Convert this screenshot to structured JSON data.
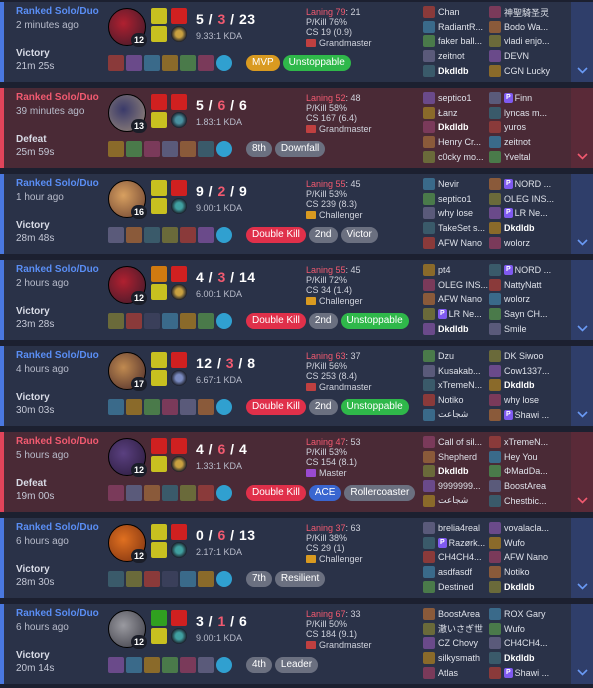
{
  "colors": {
    "win": "#4a78e0",
    "loss": "#e0445a",
    "accent_gold": "#d99a20"
  },
  "matches": [
    {
      "mode": "Ranked Solo/Duo",
      "ago": "2 minutes ago",
      "result": "Victory",
      "duration": "21m 25s",
      "outcome": "win",
      "level": "12",
      "k": "5",
      "d": "3",
      "a": "23",
      "kda": "9.33:1 KDA",
      "laning": "Laning 79",
      "laning_score": ": 21",
      "pkill": "P/Kill 76%",
      "cs": "CS 19 (0.9)",
      "rank": "Grandmaster",
      "tags": [
        {
          "label": "MVP",
          "color": "gold"
        },
        {
          "label": "Unstoppable",
          "color": "green"
        }
      ],
      "team1": [
        {
          "name": "Chan"
        },
        {
          "name": "RadiantR..."
        },
        {
          "name": "faker ball..."
        },
        {
          "name": "zeitnot"
        },
        {
          "name": "Dkdldb",
          "me": true
        }
      ],
      "team2": [
        {
          "name": "神聖騎圣灵"
        },
        {
          "name": "Bodo Wa..."
        },
        {
          "name": "vladi enjo..."
        },
        {
          "name": "DEVN"
        },
        {
          "name": "CGN Lucky"
        }
      ]
    },
    {
      "mode": "Ranked Solo/Duo",
      "ago": "39 minutes ago",
      "result": "Defeat",
      "duration": "25m 59s",
      "outcome": "loss",
      "level": "13",
      "k": "5",
      "d": "6",
      "a": "6",
      "kda": "1.83:1 KDA",
      "laning": "Laning 52",
      "laning_score": ": 48",
      "pkill": "P/Kill 58%",
      "cs": "CS 167 (6.4)",
      "rank": "Grandmaster",
      "tags": [
        {
          "label": "8th",
          "color": "gray"
        },
        {
          "label": "Downfall",
          "color": "gray"
        }
      ],
      "team1": [
        {
          "name": "septico1"
        },
        {
          "name": "Łanz"
        },
        {
          "name": "Dkdldb",
          "me": true
        },
        {
          "name": "Henry Cr..."
        },
        {
          "name": "c0cky mo..."
        }
      ],
      "team2": [
        {
          "name": "Finn",
          "badge": "P"
        },
        {
          "name": "lyncas m..."
        },
        {
          "name": "yuros"
        },
        {
          "name": "zeitnot"
        },
        {
          "name": "Yveltal"
        }
      ]
    },
    {
      "mode": "Ranked Solo/Duo",
      "ago": "1 hour ago",
      "result": "Victory",
      "duration": "28m 48s",
      "outcome": "win",
      "level": "16",
      "k": "9",
      "d": "2",
      "a": "9",
      "kda": "9.00:1 KDA",
      "laning": "Laning 55",
      "laning_score": ": 45",
      "pkill": "P/Kill 53%",
      "cs": "CS 239 (8.3)",
      "rank": "Challenger",
      "tags": [
        {
          "label": "Double Kill",
          "color": "red"
        },
        {
          "label": "2nd",
          "color": "gray"
        },
        {
          "label": "Victor",
          "color": "gray"
        }
      ],
      "team1": [
        {
          "name": "Nevir"
        },
        {
          "name": "septico1"
        },
        {
          "name": "why lose"
        },
        {
          "name": "TakeSet s..."
        },
        {
          "name": "AFW Nano"
        }
      ],
      "team2": [
        {
          "name": "NORD ...",
          "badge": "P"
        },
        {
          "name": "OLEG INS..."
        },
        {
          "name": "LR Ne...",
          "badge": "P"
        },
        {
          "name": "Dkdldb",
          "me": true
        },
        {
          "name": "wolorz"
        }
      ]
    },
    {
      "mode": "Ranked Solo/Duo",
      "ago": "2 hours ago",
      "result": "Victory",
      "duration": "23m 28s",
      "outcome": "win",
      "level": "12",
      "k": "4",
      "d": "3",
      "a": "14",
      "kda": "6.00:1 KDA",
      "laning": "Laning 55",
      "laning_score": ": 45",
      "pkill": "P/Kill 72%",
      "cs": "CS 34 (1.4)",
      "rank": "Challenger",
      "tags": [
        {
          "label": "Double Kill",
          "color": "red"
        },
        {
          "label": "2nd",
          "color": "gray"
        },
        {
          "label": "Unstoppable",
          "color": "green"
        }
      ],
      "team1": [
        {
          "name": "pt4"
        },
        {
          "name": "OLEG INS..."
        },
        {
          "name": "AFW Nano"
        },
        {
          "name": "LR Ne...",
          "badge": "P"
        },
        {
          "name": "Dkdldb",
          "me": true
        }
      ],
      "team2": [
        {
          "name": "NORD ...",
          "badge": "P"
        },
        {
          "name": "NattyNatt"
        },
        {
          "name": "wolorz"
        },
        {
          "name": "Sayn CH..."
        },
        {
          "name": "Smile"
        }
      ]
    },
    {
      "mode": "Ranked Solo/Duo",
      "ago": "4 hours ago",
      "result": "Victory",
      "duration": "30m 03s",
      "outcome": "win",
      "level": "17",
      "k": "12",
      "d": "3",
      "a": "8",
      "kda": "6.67:1 KDA",
      "laning": "Laning 63",
      "laning_score": ": 37",
      "pkill": "P/Kill 56%",
      "cs": "CS 253 (8.4)",
      "rank": "Grandmaster",
      "tags": [
        {
          "label": "Double Kill",
          "color": "red"
        },
        {
          "label": "2nd",
          "color": "gray"
        },
        {
          "label": "Unstoppable",
          "color": "green"
        }
      ],
      "team1": [
        {
          "name": "Dzu"
        },
        {
          "name": "Kusakab..."
        },
        {
          "name": "xTremeN..."
        },
        {
          "name": "Notiko"
        },
        {
          "name": "شجاعت"
        }
      ],
      "team2": [
        {
          "name": "DK Siwoo"
        },
        {
          "name": "Cow1337..."
        },
        {
          "name": "Dkdldb",
          "me": true
        },
        {
          "name": "why lose"
        },
        {
          "name": "Shawi ...",
          "badge": "P"
        }
      ]
    },
    {
      "mode": "Ranked Solo/Duo",
      "ago": "5 hours ago",
      "result": "Defeat",
      "duration": "19m 00s",
      "outcome": "loss",
      "level": "12",
      "k": "4",
      "d": "6",
      "a": "4",
      "kda": "1.33:1 KDA",
      "laning": "Laning 47",
      "laning_score": ": 53",
      "pkill": "P/Kill 53%",
      "cs": "CS 154 (8.1)",
      "rank": "Master",
      "tags": [
        {
          "label": "Double Kill",
          "color": "red"
        },
        {
          "label": "ACE",
          "color": "blue"
        },
        {
          "label": "Rollercoaster",
          "color": "gray"
        }
      ],
      "team1": [
        {
          "name": "Call of sil..."
        },
        {
          "name": "Shepherd"
        },
        {
          "name": "Dkdldb",
          "me": true
        },
        {
          "name": "9999999..."
        },
        {
          "name": "شجاعت"
        }
      ],
      "team2": [
        {
          "name": "xTremeN..."
        },
        {
          "name": "Hey You"
        },
        {
          "name": "ΦMadDa..."
        },
        {
          "name": "BoostArea"
        },
        {
          "name": "Chestbic..."
        }
      ]
    },
    {
      "mode": "Ranked Solo/Duo",
      "ago": "6 hours ago",
      "result": "Victory",
      "duration": "28m 30s",
      "outcome": "win",
      "level": "12",
      "k": "0",
      "d": "6",
      "a": "13",
      "kda": "2.17:1 KDA",
      "laning": "Laning 37",
      "laning_score": ": 63",
      "pkill": "P/Kill 38%",
      "cs": "CS 29 (1)",
      "rank": "Challenger",
      "tags": [
        {
          "label": "7th",
          "color": "gray"
        },
        {
          "label": "Resilient",
          "color": "gray"
        }
      ],
      "team1": [
        {
          "name": "brelia4real"
        },
        {
          "name": "Razørk...",
          "badge": "P"
        },
        {
          "name": "CH4CH4..."
        },
        {
          "name": "asdfasdf"
        },
        {
          "name": "Destined"
        }
      ],
      "team2": [
        {
          "name": "vovalacla..."
        },
        {
          "name": "Wufo"
        },
        {
          "name": "AFW Nano"
        },
        {
          "name": "Notiko"
        },
        {
          "name": "Dkdldb",
          "me": true
        }
      ]
    },
    {
      "mode": "Ranked Solo/Duo",
      "ago": "6 hours ago",
      "result": "Victory",
      "duration": "20m 14s",
      "outcome": "win",
      "level": "12",
      "k": "3",
      "d": "1",
      "a": "6",
      "kda": "9.00:1 KDA",
      "laning": "Laning 67",
      "laning_score": ": 33",
      "pkill": "P/Kill 50%",
      "cs": "CS 184 (9.1)",
      "rank": "Grandmaster",
      "tags": [
        {
          "label": "4th",
          "color": "gray"
        },
        {
          "label": "Leader",
          "color": "gray"
        }
      ],
      "team1": [
        {
          "name": "BoostArea"
        },
        {
          "name": "澈いさぎ世"
        },
        {
          "name": "CZ Chovy"
        },
        {
          "name": "silkysmath"
        },
        {
          "name": "Atlas"
        }
      ],
      "team2": [
        {
          "name": "ROX Gary"
        },
        {
          "name": "Wufo"
        },
        {
          "name": "CH4CH4..."
        },
        {
          "name": "Dkdldb",
          "me": true
        },
        {
          "name": "Shawi ...",
          "badge": "P"
        }
      ]
    }
  ]
}
